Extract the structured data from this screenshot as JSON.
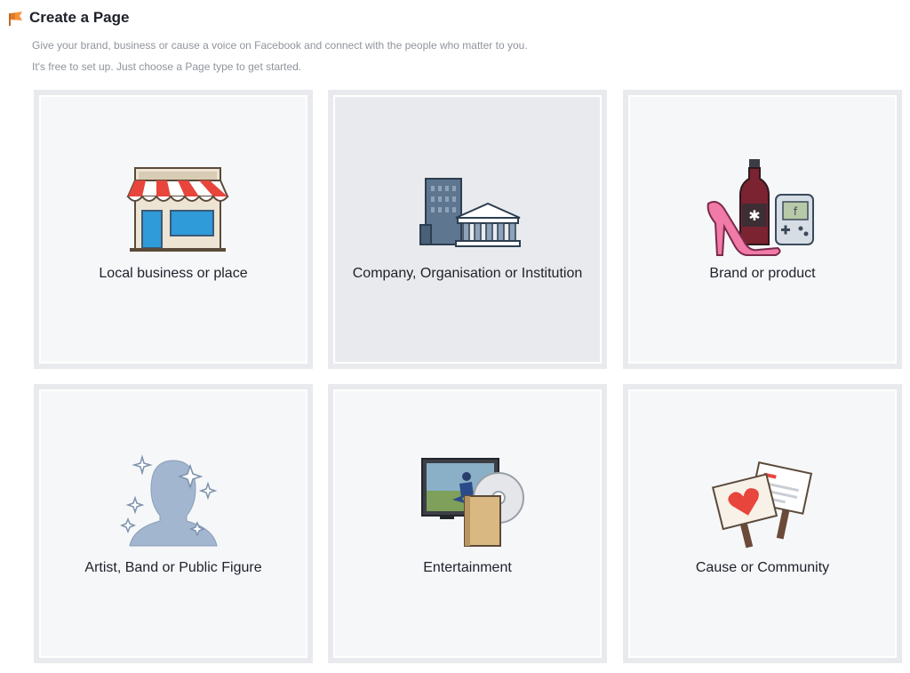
{
  "header": {
    "title": "Create a Page",
    "subtitle_line1": "Give your brand, business or cause a voice on Facebook and connect with the people who matter to you.",
    "subtitle_line2": "It's free to set up. Just choose a Page type to get started."
  },
  "tiles": [
    {
      "label": "Local business or place",
      "icon": "storefront-icon"
    },
    {
      "label": "Company, Organisation or Institution",
      "icon": "buildings-icon"
    },
    {
      "label": "Brand or product",
      "icon": "products-icon"
    },
    {
      "label": "Artist, Band or Public Figure",
      "icon": "person-silhouette-icon"
    },
    {
      "label": "Entertainment",
      "icon": "entertainment-icon"
    },
    {
      "label": "Cause or Community",
      "icon": "protest-signs-icon"
    }
  ],
  "colors": {
    "title": "#1d2129",
    "subtitle": "#90949c",
    "tile_border": "#e9eaed",
    "tile_bg": "#f6f7f9",
    "tile_hover_bg": "#e9eaed",
    "flag_orange": "#f7923b"
  }
}
